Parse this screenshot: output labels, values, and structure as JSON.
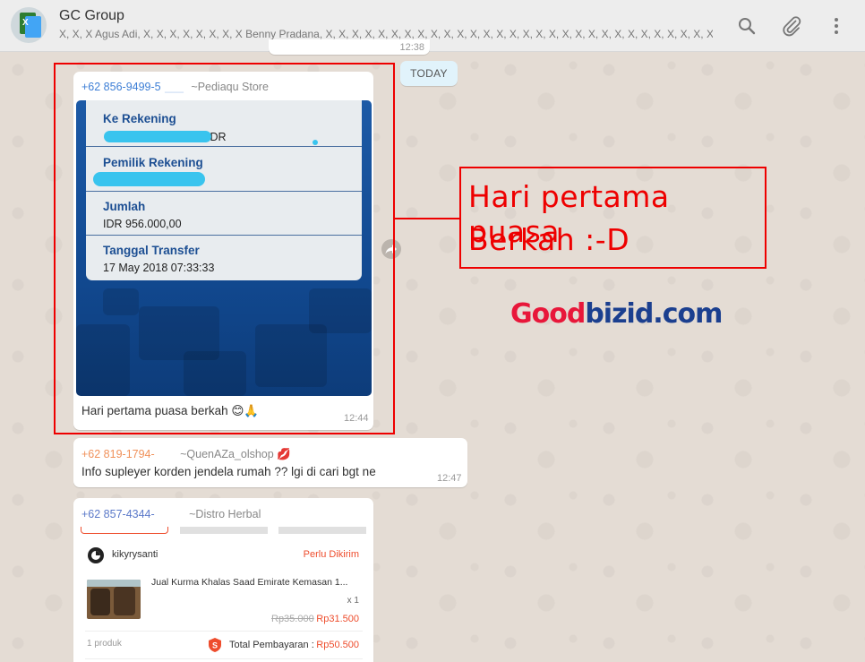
{
  "header": {
    "title": "GC Group",
    "participants": "X, X, X Agus Adi, X, X, X, X, X, X, X, X Benny Pradana, X, X, X, X, X, X, X, X, X, X, X, X, X, X, X, X, X, X, X, X, X, X, X, X, X, X, X, X, X, X, X, X, X Phan…",
    "icons": [
      "search-icon",
      "paperclip-icon",
      "menu-dots-icon"
    ]
  },
  "date_divider": "TODAY",
  "prev_time": "12:38",
  "messages": [
    {
      "phone": "+62 856-9499-5",
      "name": "~Pediaqu Store",
      "text": "Hari pertama puasa berkah 😊🙏",
      "time": "12:44",
      "receipt": {
        "rows": [
          {
            "label": "Ke Rekening",
            "value": "IDR"
          },
          {
            "label": "Pemilik Rekening",
            "value": ""
          },
          {
            "label": "Jumlah",
            "value": "IDR 956.000,00"
          },
          {
            "label": "Tanggal Transfer",
            "value": "17 May 2018 07:33:33"
          }
        ]
      }
    },
    {
      "phone": "+62 819-1794-",
      "name": "~QuenAZa_olshop 💋",
      "text": "Info supleyer korden jendela rumah ?? lgi di cari bgt ne",
      "time": "12:47"
    },
    {
      "phone": "+62 857-4344-",
      "name": "~Distro Herbal",
      "shop": {
        "user": "kikyrysanti",
        "status": "Perlu Dikirim",
        "product": "Jual Kurma Khalas Saad Emirate Kemasan 1...",
        "qty": "x 1",
        "old_price": "Rp35.000",
        "price": "Rp31.500",
        "count": "1 produk",
        "total_label": "Total Pembayaran :",
        "total": "Rp50.500"
      }
    }
  ],
  "annotation": {
    "line1": "Hari pertama puasa",
    "line2": "Berkah :-D"
  },
  "brand": {
    "part1": "Good",
    "part2": "bizid.com"
  }
}
